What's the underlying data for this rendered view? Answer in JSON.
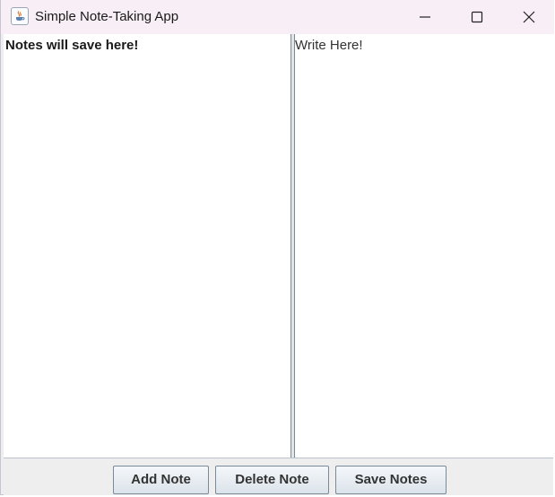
{
  "window": {
    "title": "Simple Note-Taking App",
    "icon": "java-cup-icon",
    "controls": [
      "minimize-icon",
      "maximize-icon",
      "close-icon"
    ]
  },
  "notes_pane": {
    "label": "Notes will save here!"
  },
  "editor": {
    "value": "Write Here!"
  },
  "buttons": {
    "add_label": "Add Note",
    "delete_label": "Delete Note",
    "save_label": "Save Notes"
  },
  "colors": {
    "titlebar": "#f7eef6",
    "button_border": "#7a8a99",
    "button_fill": "#dbe3ea"
  }
}
